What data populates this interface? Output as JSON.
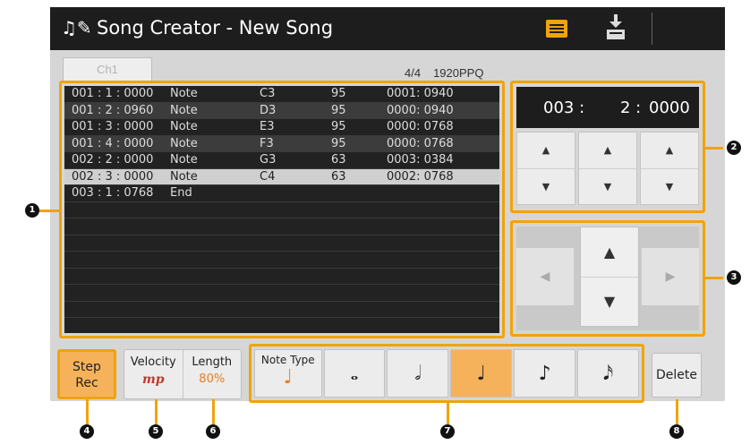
{
  "window": {
    "title_icon": "♫✎",
    "title": "Song Creator - New Song"
  },
  "toolbar": {
    "list_icon": "list-icon",
    "save_icon": "save-icon"
  },
  "tab": {
    "label": "Ch1"
  },
  "meter": {
    "time_signature": "4/4",
    "ppq": "1920PPQ"
  },
  "events": [
    {
      "pos": "001 : 1 : 0000",
      "type": "Note",
      "note": "C3",
      "vel": "95",
      "len": "0001:  0940"
    },
    {
      "pos": "001 : 2 : 0960",
      "type": "Note",
      "note": "D3",
      "vel": "95",
      "len": "0000:  0940"
    },
    {
      "pos": "001 : 3 : 0000",
      "type": "Note",
      "note": "E3",
      "vel": "95",
      "len": "0000:  0768"
    },
    {
      "pos": "001 : 4 : 0000",
      "type": "Note",
      "note": "F3",
      "vel": "95",
      "len": "0000:  0768"
    },
    {
      "pos": "002 : 2 : 0000",
      "type": "Note",
      "note": "G3",
      "vel": "63",
      "len": "0003:  0384"
    },
    {
      "pos": "002 : 3 : 0000",
      "type": "Note",
      "note": "C4",
      "vel": "63",
      "len": "0002:  0768"
    },
    {
      "pos": "003 : 1 : 0768",
      "type": "End",
      "note": "",
      "vel": "",
      "len": ""
    }
  ],
  "position": {
    "bar": "003 :",
    "beat": "2 :",
    "tick": "0000"
  },
  "spinners": {
    "up": "▲",
    "down": "▼"
  },
  "nav": {
    "up": "▲",
    "down": "▼",
    "left": "◀",
    "right": "▶"
  },
  "step_rec": {
    "line1": "Step",
    "line2": "Rec"
  },
  "velocity": {
    "label": "Velocity",
    "value": "mp"
  },
  "length": {
    "label": "Length",
    "value": "80%"
  },
  "note_type": {
    "label": "Note Type",
    "current": "♩",
    "options": [
      "𝅝",
      "𝅗𝅥",
      "♩",
      "♪",
      "𝅘𝅥𝅯"
    ]
  },
  "delete_label": "Delete",
  "callouts": [
    "1",
    "2",
    "3",
    "4",
    "5",
    "6",
    "7",
    "8"
  ],
  "colors": {
    "accent": "#f0a30a",
    "selected_fill": "#f6b25a",
    "titlebar": "#1d1d1d"
  }
}
